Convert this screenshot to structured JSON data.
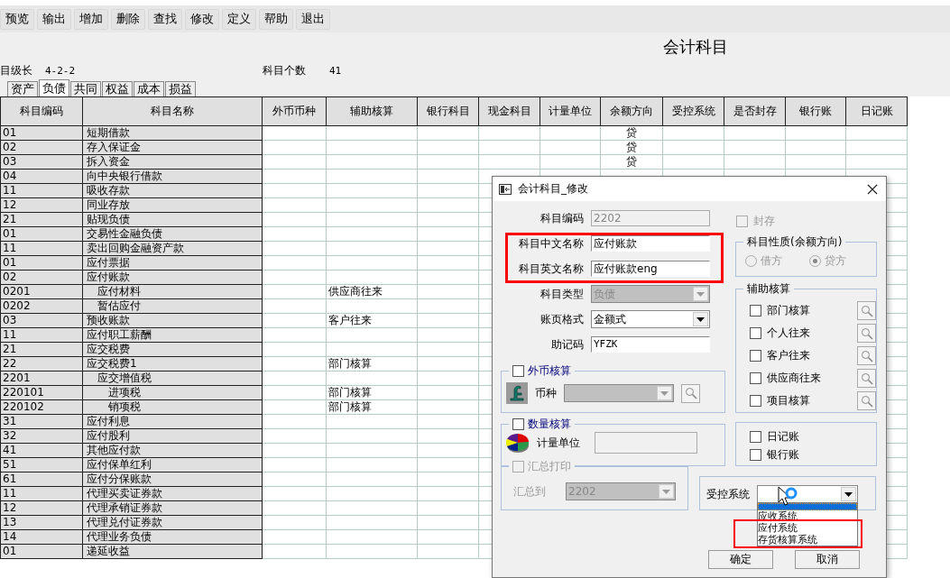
{
  "toolbar": [
    {
      "label": "预览"
    },
    {
      "label": "输出"
    },
    {
      "label": "增加"
    },
    {
      "label": "删除"
    },
    {
      "label": "查找"
    },
    {
      "label": "修改"
    },
    {
      "label": "定义"
    },
    {
      "label": "帮助"
    },
    {
      "label": "退出"
    }
  ],
  "title": "会计科目",
  "info": {
    "level_label": "目级长",
    "level_value": "4-2-2",
    "count_label": "科目个数",
    "count_value": "41"
  },
  "tabs": [
    {
      "label": "资产",
      "selected": false
    },
    {
      "label": "负债",
      "selected": true
    },
    {
      "label": "共同",
      "selected": false
    },
    {
      "label": "权益",
      "selected": false
    },
    {
      "label": "成本",
      "selected": false
    },
    {
      "label": "损益",
      "selected": false
    }
  ],
  "table": {
    "columns": [
      "科目编码",
      "科目名称",
      "外币币种",
      "辅助核算",
      "银行科目",
      "现金科目",
      "计量单位",
      "余额方向",
      "受控系统",
      "是否封存",
      "银行账",
      "日记账"
    ],
    "rows": [
      {
        "code": "01",
        "name": "短期借款",
        "direction": "贷"
      },
      {
        "code": "02",
        "name": "存入保证金",
        "direction": "贷"
      },
      {
        "code": "03",
        "name": "拆入资金",
        "direction": "贷"
      },
      {
        "code": "04",
        "name": "向中央银行借款"
      },
      {
        "code": "11",
        "name": "吸收存款"
      },
      {
        "code": "12",
        "name": "同业存放"
      },
      {
        "code": "21",
        "name": "贴现负债"
      },
      {
        "code": "01",
        "name": "交易性金融负债"
      },
      {
        "code": "11",
        "name": "卖出回购金融资产款"
      },
      {
        "code": "01",
        "name": "应付票据"
      },
      {
        "code": "02",
        "name": "应付账款",
        "children": [
          {
            "code": "0201",
            "name": "应付材料",
            "aux": "供应商往来"
          },
          {
            "code": "0202",
            "name": "暂估应付"
          }
        ]
      },
      {
        "code": "03",
        "name": "预收账款",
        "aux": "客户往来"
      },
      {
        "code": "11",
        "name": "应付职工薪酬"
      },
      {
        "code": "21",
        "name": "应交税费"
      },
      {
        "code": "22",
        "name": "应交税费1",
        "aux": "部门核算",
        "children": [
          {
            "code": "2201",
            "name": "应交增值税",
            "children": [
              {
                "code": "220101",
                "name": "进项税",
                "aux": "部门核算"
              },
              {
                "code": "220102",
                "name": "销项税",
                "aux": "部门核算"
              }
            ]
          }
        ]
      },
      {
        "code": "31",
        "name": "应付利息"
      },
      {
        "code": "32",
        "name": "应付股利"
      },
      {
        "code": "41",
        "name": "其他应付款"
      },
      {
        "code": "51",
        "name": "应付保单红利"
      },
      {
        "code": "61",
        "name": "应付分保账款"
      },
      {
        "code": "11",
        "name": "代理买卖证券款"
      },
      {
        "code": "12",
        "name": "代理承销证券款"
      },
      {
        "code": "13",
        "name": "代理兑付证券款"
      },
      {
        "code": "14",
        "name": "代理业务负债"
      },
      {
        "code": "01",
        "name": "递延收益"
      }
    ]
  },
  "dialog": {
    "title": "会计科目_修改",
    "fields": [
      {
        "label": "科目编码",
        "value": "2202",
        "kind": "text",
        "disabled": true
      },
      {
        "label": "科目中文名称",
        "value": "应付账款",
        "kind": "text",
        "disabled": false
      },
      {
        "label": "科目英文名称",
        "value": "应付账款eng",
        "kind": "text",
        "disabled": false
      },
      {
        "label": "科目类型",
        "value": "负债",
        "kind": "select",
        "disabled": true
      },
      {
        "label": "账页格式",
        "value": "金额式",
        "kind": "select",
        "disabled": false
      },
      {
        "label": "助记码",
        "value": "YFZK",
        "kind": "text",
        "disabled": false
      }
    ],
    "sealed": {
      "label": "封存",
      "checked": false,
      "disabled": true
    },
    "nature": {
      "title": "科目性质(余额方向)",
      "disabled": true,
      "options": [
        {
          "label": "借方",
          "selected": false
        },
        {
          "label": "贷方",
          "selected": true
        }
      ]
    },
    "auxiliary": {
      "title": "辅助核算",
      "items": [
        {
          "label": "部门核算",
          "checked": false
        },
        {
          "label": "个人往来",
          "checked": false
        },
        {
          "label": "客户往来",
          "checked": false
        },
        {
          "label": "供应商往来",
          "checked": false
        },
        {
          "label": "项目核算",
          "checked": false
        }
      ]
    },
    "foreign": {
      "label": "外币核算",
      "checked": false,
      "currency_label": "币种"
    },
    "quantity": {
      "label": "数量核算",
      "checked": false,
      "unit_label": "计量单位"
    },
    "books": [
      {
        "label": "日记账",
        "checked": false
      },
      {
        "label": "银行账",
        "checked": false
      }
    ],
    "summary": {
      "label": "汇总打印",
      "checked": false,
      "disabled": true,
      "target_label": "汇总到",
      "target_value": "2202"
    },
    "controlled": {
      "label": "受控系统",
      "open": true,
      "blank_highlighted": true,
      "options": [
        {
          "label": "应收系统",
          "selected": false
        },
        {
          "label": "应付系统",
          "selected": false
        },
        {
          "label": "存货核算系统",
          "selected": false
        }
      ]
    },
    "buttons": [
      {
        "label": "确定"
      },
      {
        "label": "取消"
      }
    ]
  }
}
